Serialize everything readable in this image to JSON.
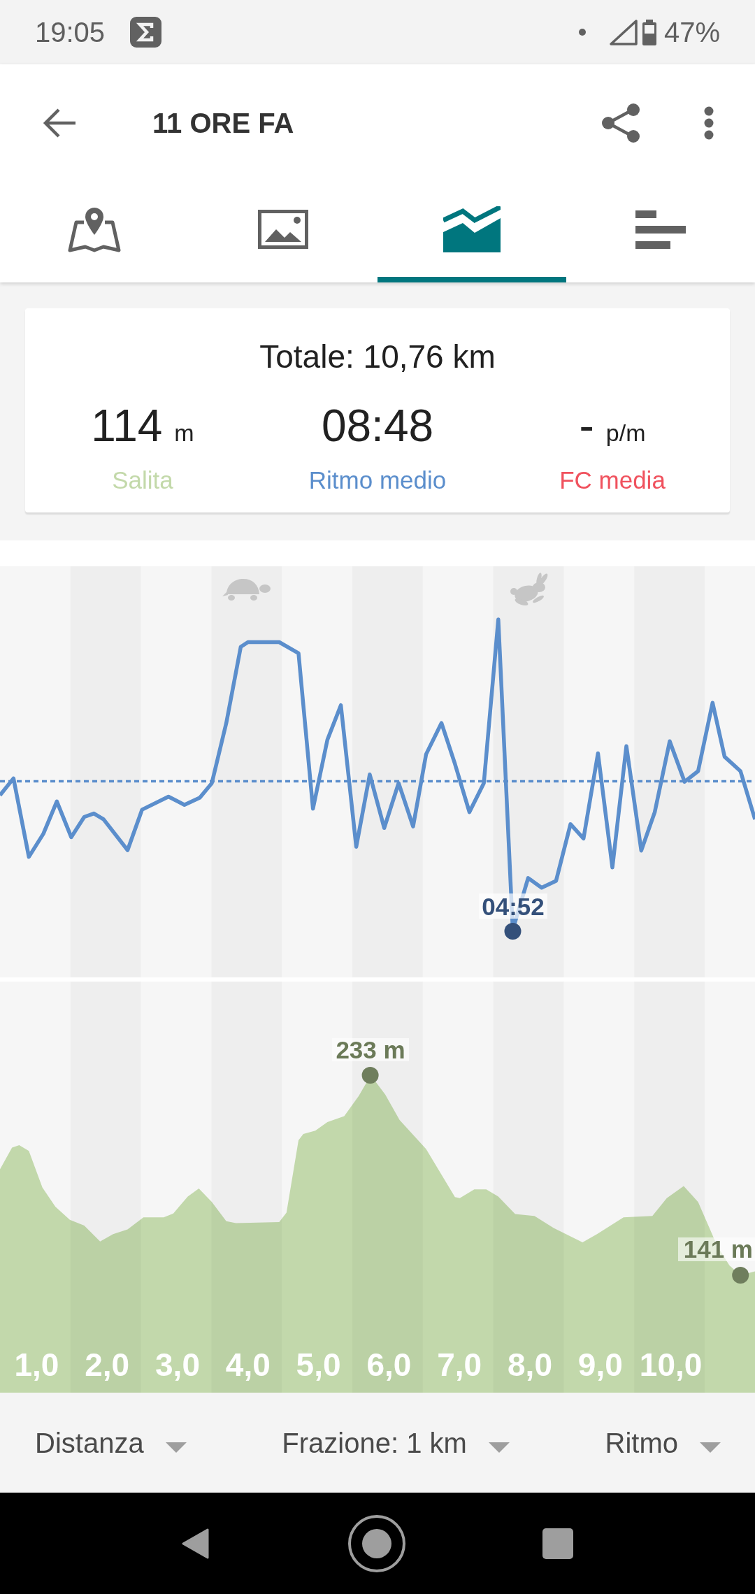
{
  "status_bar": {
    "time": "19:05",
    "battery": "47%"
  },
  "app_bar": {
    "title": "11 ORE FA"
  },
  "tabs": [
    {
      "kind": "map",
      "selected": false
    },
    {
      "kind": "photos",
      "selected": false
    },
    {
      "kind": "charts",
      "selected": true
    },
    {
      "kind": "laps",
      "selected": false
    }
  ],
  "summary": {
    "total": "Totale: 10,76 km",
    "stats": [
      {
        "value": "114",
        "unit": "m",
        "label": "Salita",
        "color": "#c3d9aa"
      },
      {
        "value": "08:48",
        "label": "Ritmo medio",
        "color": "#5b8ecc"
      },
      {
        "value": "-",
        "unit": "p/m",
        "label": "FC media",
        "color": "#f0525e"
      }
    ]
  },
  "pace_chart": {
    "min_label": "04:52"
  },
  "elevation_chart": {
    "max_label": "233 m",
    "end_label": "141 m",
    "x_labels": [
      "1,0",
      "2,0",
      "3,0",
      "4,0",
      "5,0",
      "6,0",
      "7,0",
      "8,0",
      "9,0",
      "10,0"
    ]
  },
  "filters": [
    {
      "label": "Distanza"
    },
    {
      "label": "Frazione: 1 km"
    },
    {
      "label": "Ritmo"
    }
  ]
}
